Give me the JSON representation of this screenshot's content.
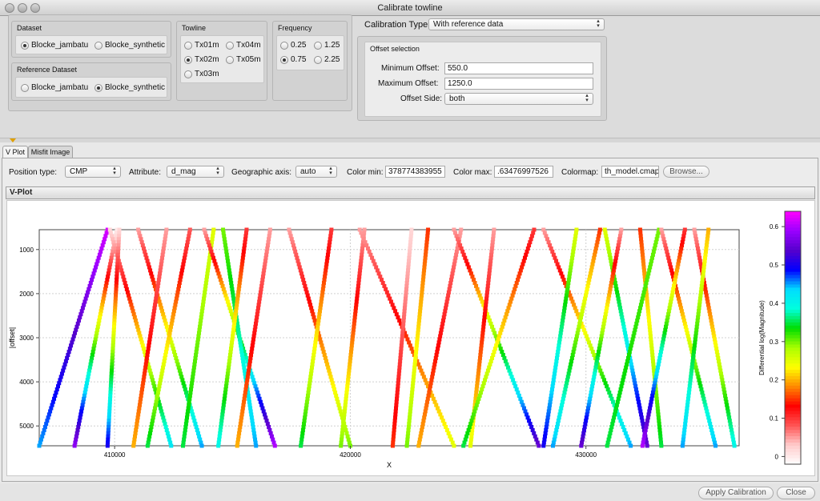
{
  "window": {
    "title": "Calibrate towline"
  },
  "dataset": {
    "label": "Dataset",
    "options": [
      "Blocke_jambatu",
      "Blocke_synthetic"
    ],
    "selected": 0
  },
  "reference_dataset": {
    "label": "Reference Dataset",
    "options": [
      "Blocke_jambatu",
      "Blocke_synthetic"
    ],
    "selected": 1
  },
  "towline": {
    "label": "Towline",
    "options": [
      "Tx01m",
      "Tx04m",
      "Tx02m",
      "Tx05m",
      "Tx03m"
    ],
    "selected": 2
  },
  "frequency": {
    "label": "Frequency",
    "options": [
      "0.25",
      "1.25",
      "0.75",
      "2.25"
    ],
    "selected": 2
  },
  "calibration": {
    "label": "Calibration Type:",
    "value": "With reference data"
  },
  "offset_selection": {
    "label": "Offset selection",
    "min_label": "Minimum Offset:",
    "min_value": "550.0",
    "max_label": "Maximum Offset:",
    "max_value": "1250.0",
    "side_label": "Offset Side:",
    "side_value": "both"
  },
  "tabs": [
    "V Plot",
    "Misfit Image"
  ],
  "controls": {
    "position_type_label": "Position type:",
    "position_type_value": "CMP",
    "attribute_label": "Attribute:",
    "attribute_value": "d_mag",
    "geo_axis_label": "Geographic axis:",
    "geo_axis_value": "auto",
    "color_min_label": "Color min:",
    "color_min_value": "378774383955",
    "color_max_label": "Color max:",
    "color_max_value": ".63476997526",
    "colormap_label": "Colormap:",
    "colormap_value": "th_model.cmap",
    "browse_label": "Browse..."
  },
  "section_title": "V-Plot",
  "buttons": {
    "apply": "Apply Calibration",
    "close": "Close"
  },
  "chart_data": {
    "type": "heatmap",
    "title": "",
    "xlabel": "X",
    "ylabel": "|offset|",
    "x_ticks": [
      410000,
      420000,
      430000
    ],
    "y_ticks": [
      1000,
      2000,
      3000,
      4000,
      5000
    ],
    "xlim": [
      406800,
      436500
    ],
    "ylim": [
      5450,
      550
    ],
    "y_inverted": true,
    "grid": true,
    "colorbar": {
      "label": "Differential log(Magnitude)",
      "ticks": [
        0,
        0.1,
        0.2,
        0.3,
        0.4,
        0.5,
        0.6
      ],
      "range": [
        -0.02,
        0.64
      ],
      "colors": [
        "#ffffff",
        "#ffcccc",
        "#ff5555",
        "#ff0000",
        "#ff8800",
        "#ffff00",
        "#aaff00",
        "#00dd00",
        "#00ffdd",
        "#00ddff",
        "#0000ff",
        "#5500cc",
        "#9900ff",
        "#ff00ff"
      ]
    },
    "series": [
      {
        "x_start": 409700,
        "x_end": 406800,
        "v_start": 0.62,
        "v_end": 0.45
      },
      {
        "x_start": 410100,
        "x_end": 408300,
        "v_start": 0.0,
        "v_end": 0.58
      },
      {
        "x_start": 409800,
        "x_end": 412400,
        "v_start": 0.02,
        "v_end": 0.42
      },
      {
        "x_start": 410200,
        "x_end": 409700,
        "v_start": 0.02,
        "v_end": 0.5
      },
      {
        "x_start": 411000,
        "x_end": 413700,
        "v_start": 0.05,
        "v_end": 0.45
      },
      {
        "x_start": 412200,
        "x_end": 410800,
        "v_start": 0.05,
        "v_end": 0.2
      },
      {
        "x_start": 413200,
        "x_end": 411400,
        "v_start": 0.08,
        "v_end": 0.35
      },
      {
        "x_start": 414200,
        "x_end": 412900,
        "v_start": 0.25,
        "v_end": 0.35
      },
      {
        "x_start": 413800,
        "x_end": 416800,
        "v_start": 0.05,
        "v_end": 0.6
      },
      {
        "x_start": 414600,
        "x_end": 416000,
        "v_start": 0.3,
        "v_end": 0.45
      },
      {
        "x_start": 415600,
        "x_end": 414400,
        "v_start": 0.1,
        "v_end": 0.4
      },
      {
        "x_start": 416600,
        "x_end": 415200,
        "v_start": 0.05,
        "v_end": 0.2
      },
      {
        "x_start": 417400,
        "x_end": 420000,
        "v_start": 0.05,
        "v_end": 0.3
      },
      {
        "x_start": 419200,
        "x_end": 417900,
        "v_start": 0.1,
        "v_end": 0.35
      },
      {
        "x_start": 420600,
        "x_end": 419600,
        "v_start": 0.05,
        "v_end": 0.3
      },
      {
        "x_start": 420400,
        "x_end": 424400,
        "v_start": 0.05,
        "v_end": 0.25
      },
      {
        "x_start": 422600,
        "x_end": 421800,
        "v_start": 0.02,
        "v_end": 0.15
      },
      {
        "x_start": 423300,
        "x_end": 422400,
        "v_start": 0.15,
        "v_end": 0.3
      },
      {
        "x_start": 424700,
        "x_end": 422900,
        "v_start": 0.05,
        "v_end": 0.2
      },
      {
        "x_start": 424400,
        "x_end": 428000,
        "v_start": 0.05,
        "v_end": 0.55
      },
      {
        "x_start": 426100,
        "x_end": 425100,
        "v_start": 0.05,
        "v_end": 0.25
      },
      {
        "x_start": 427800,
        "x_end": 424800,
        "v_start": 0.1,
        "v_end": 0.35
      },
      {
        "x_start": 428200,
        "x_end": 431900,
        "v_start": 0.05,
        "v_end": 0.45
      },
      {
        "x_start": 429600,
        "x_end": 428200,
        "v_start": 0.25,
        "v_end": 0.5
      },
      {
        "x_start": 430600,
        "x_end": 428600,
        "v_start": 0.15,
        "v_end": 0.45
      },
      {
        "x_start": 430800,
        "x_end": 432600,
        "v_start": 0.25,
        "v_end": 0.55
      },
      {
        "x_start": 431500,
        "x_end": 429800,
        "v_start": 0.05,
        "v_end": 0.55
      },
      {
        "x_start": 432300,
        "x_end": 433200,
        "v_start": 0.15,
        "v_end": 0.35
      },
      {
        "x_start": 433100,
        "x_end": 430900,
        "v_start": 0.3,
        "v_end": 0.35
      },
      {
        "x_start": 433200,
        "x_end": 435500,
        "v_start": 0.05,
        "v_end": 0.45
      },
      {
        "x_start": 434200,
        "x_end": 432400,
        "v_start": 0.1,
        "v_end": 0.6
      },
      {
        "x_start": 434600,
        "x_end": 436300,
        "v_start": 0.05,
        "v_end": 0.4
      },
      {
        "x_start": 435200,
        "x_end": 434100,
        "v_start": 0.2,
        "v_end": 0.45
      }
    ]
  }
}
